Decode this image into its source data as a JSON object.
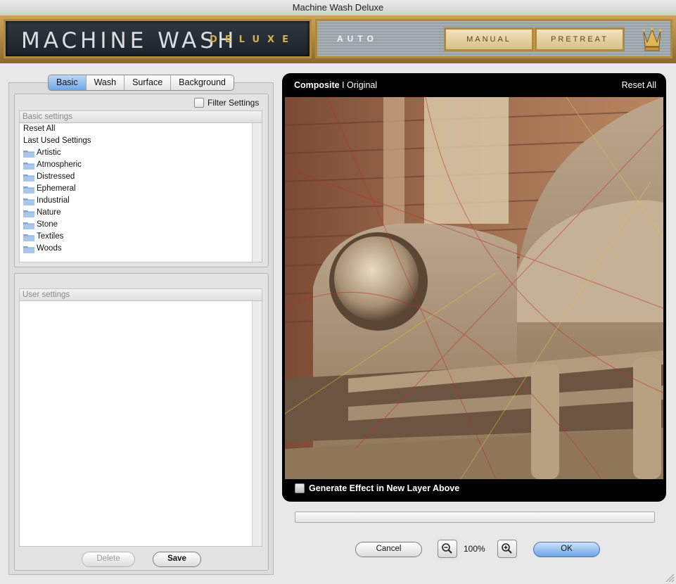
{
  "window": {
    "title": "Machine Wash Deluxe"
  },
  "banner": {
    "logo_main": "MACHINE WASH",
    "logo_sub": "DELUXE",
    "auto_label": "AUTO",
    "manual_label": "MANUAL",
    "pretreat_label": "PRETREAT"
  },
  "tabs": [
    {
      "label": "Basic",
      "active": true
    },
    {
      "label": "Wash",
      "active": false
    },
    {
      "label": "Surface",
      "active": false
    },
    {
      "label": "Background",
      "active": false
    }
  ],
  "filter_settings_label": "Filter Settings",
  "basic_settings": {
    "header": "Basic settings",
    "items": [
      {
        "label": "Reset All",
        "icon": ""
      },
      {
        "label": "Last Used Settings",
        "icon": ""
      },
      {
        "label": "Artistic",
        "icon": "folder-icon"
      },
      {
        "label": "Atmospheric",
        "icon": "folder-icon"
      },
      {
        "label": "Distressed",
        "icon": "folder-icon"
      },
      {
        "label": "Ephemeral",
        "icon": "folder-icon"
      },
      {
        "label": "Industrial",
        "icon": "folder-icon"
      },
      {
        "label": "Nature",
        "icon": "folder-icon"
      },
      {
        "label": "Stone",
        "icon": "folder-icon"
      },
      {
        "label": "Textiles",
        "icon": "folder-icon"
      },
      {
        "label": "Woods",
        "icon": "folder-icon"
      }
    ]
  },
  "user_settings": {
    "header": "User settings"
  },
  "buttons": {
    "delete": "Delete",
    "save": "Save",
    "cancel": "Cancel",
    "ok": "OK"
  },
  "preview": {
    "composite_label": "Composite",
    "separator": "I",
    "original_label": "Original",
    "reset_all": "Reset All",
    "generate_label": "Generate Effect in New Layer Above"
  },
  "zoom": {
    "level": "100%"
  },
  "colors": {
    "accent": "#6ea6e8",
    "banner_gold": "#b08a3c",
    "logo_gold": "#d8ae4d"
  }
}
